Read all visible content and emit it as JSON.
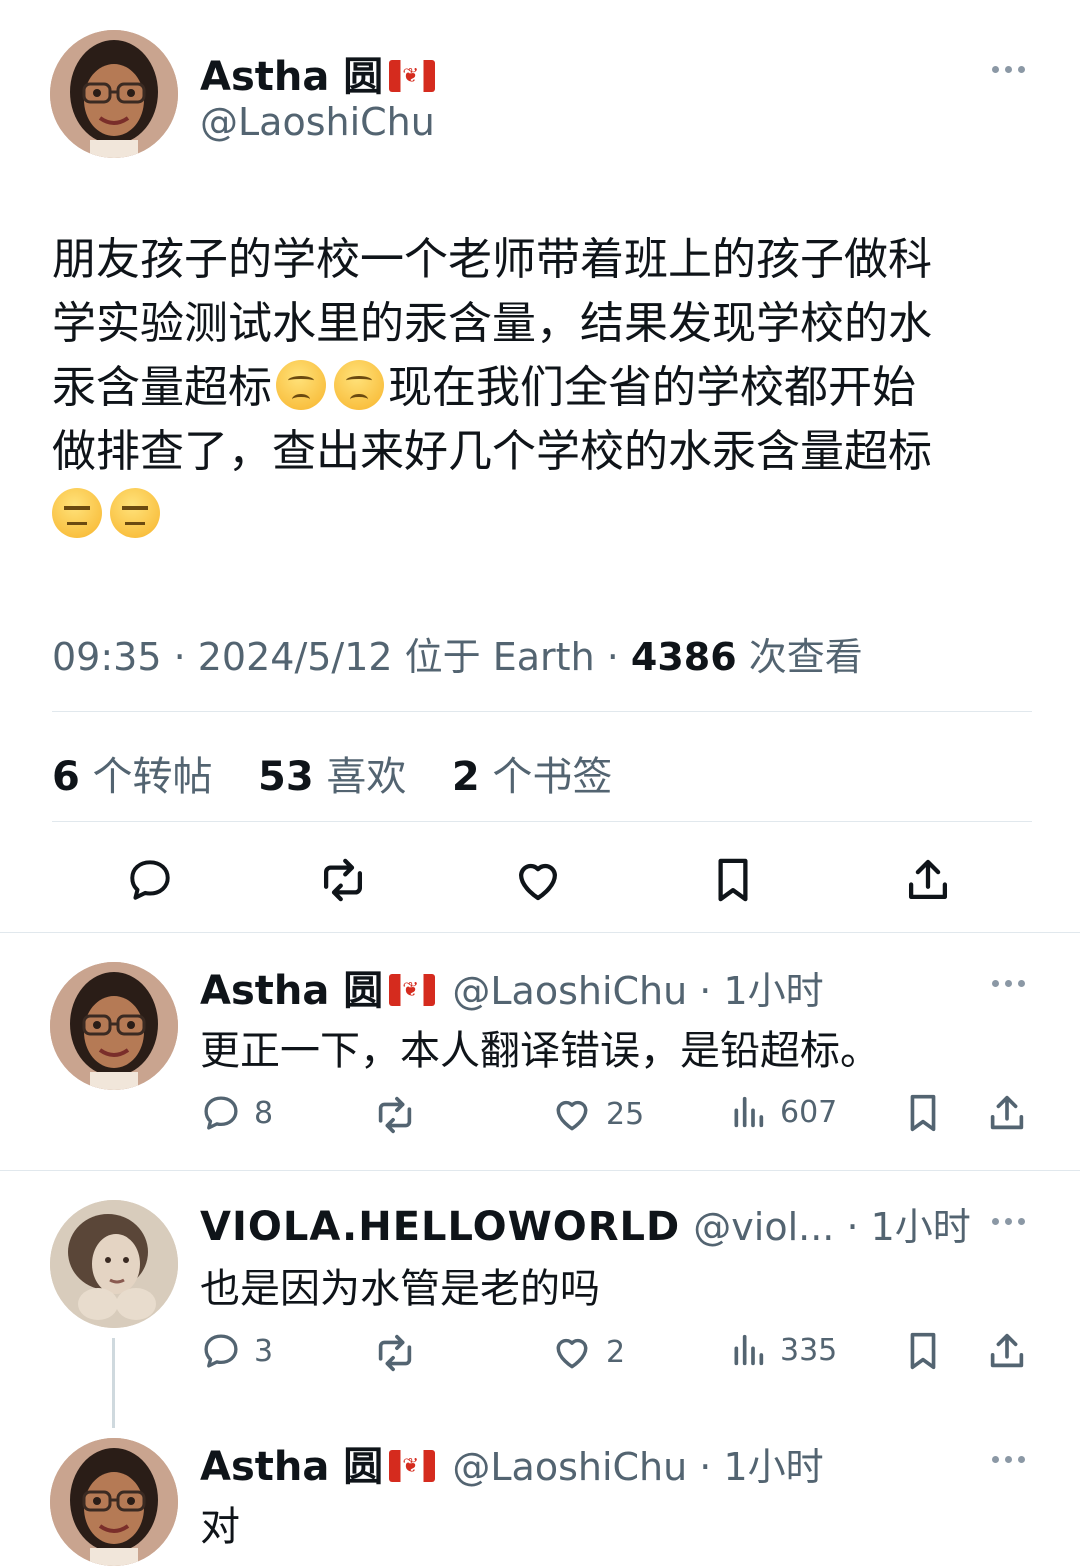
{
  "main_tweet": {
    "author_name": "Astha 圆",
    "author_handle": "@LaoshiChu",
    "text_line1": "朋友孩子的学校一个老师带着班上的孩子做科",
    "text_line2": "学实验测试水里的汞含量，结果发现学校的水",
    "text_line3a": "汞含量超标",
    "text_line3b": "现在我们全省的学校都开始",
    "text_line4": "做排查了，查出来好几个学校的水汞含量超标",
    "time": "09:35 · 2024/5/12 位于 Earth · ",
    "views_count": "4386",
    "views_label": " 次查看",
    "reposts_count": "6",
    "reposts_label": " 个转帖",
    "likes_count": "53",
    "likes_label": " 喜欢",
    "bookmarks_count": "2",
    "bookmarks_label": " 个书签"
  },
  "replies": [
    {
      "name": "Astha 圆",
      "handle": "@LaoshiChu · 1小时",
      "text": "更正一下，本人翻译错误，是铅超标。",
      "reply_count": "8",
      "like_count": "25",
      "view_count": "607"
    },
    {
      "name": "VIOLA.HELLOWORLD",
      "handle": "@viol... · 1小时",
      "text": "也是因为水管是老的吗",
      "reply_count": "3",
      "like_count": "2",
      "view_count": "335"
    },
    {
      "name": "Astha 圆",
      "handle": "@LaoshiChu · 1小时",
      "text": "对"
    }
  ],
  "colors": {
    "text_primary": "#0f1419",
    "text_secondary": "#536471",
    "divider": "#e1e8ed"
  }
}
